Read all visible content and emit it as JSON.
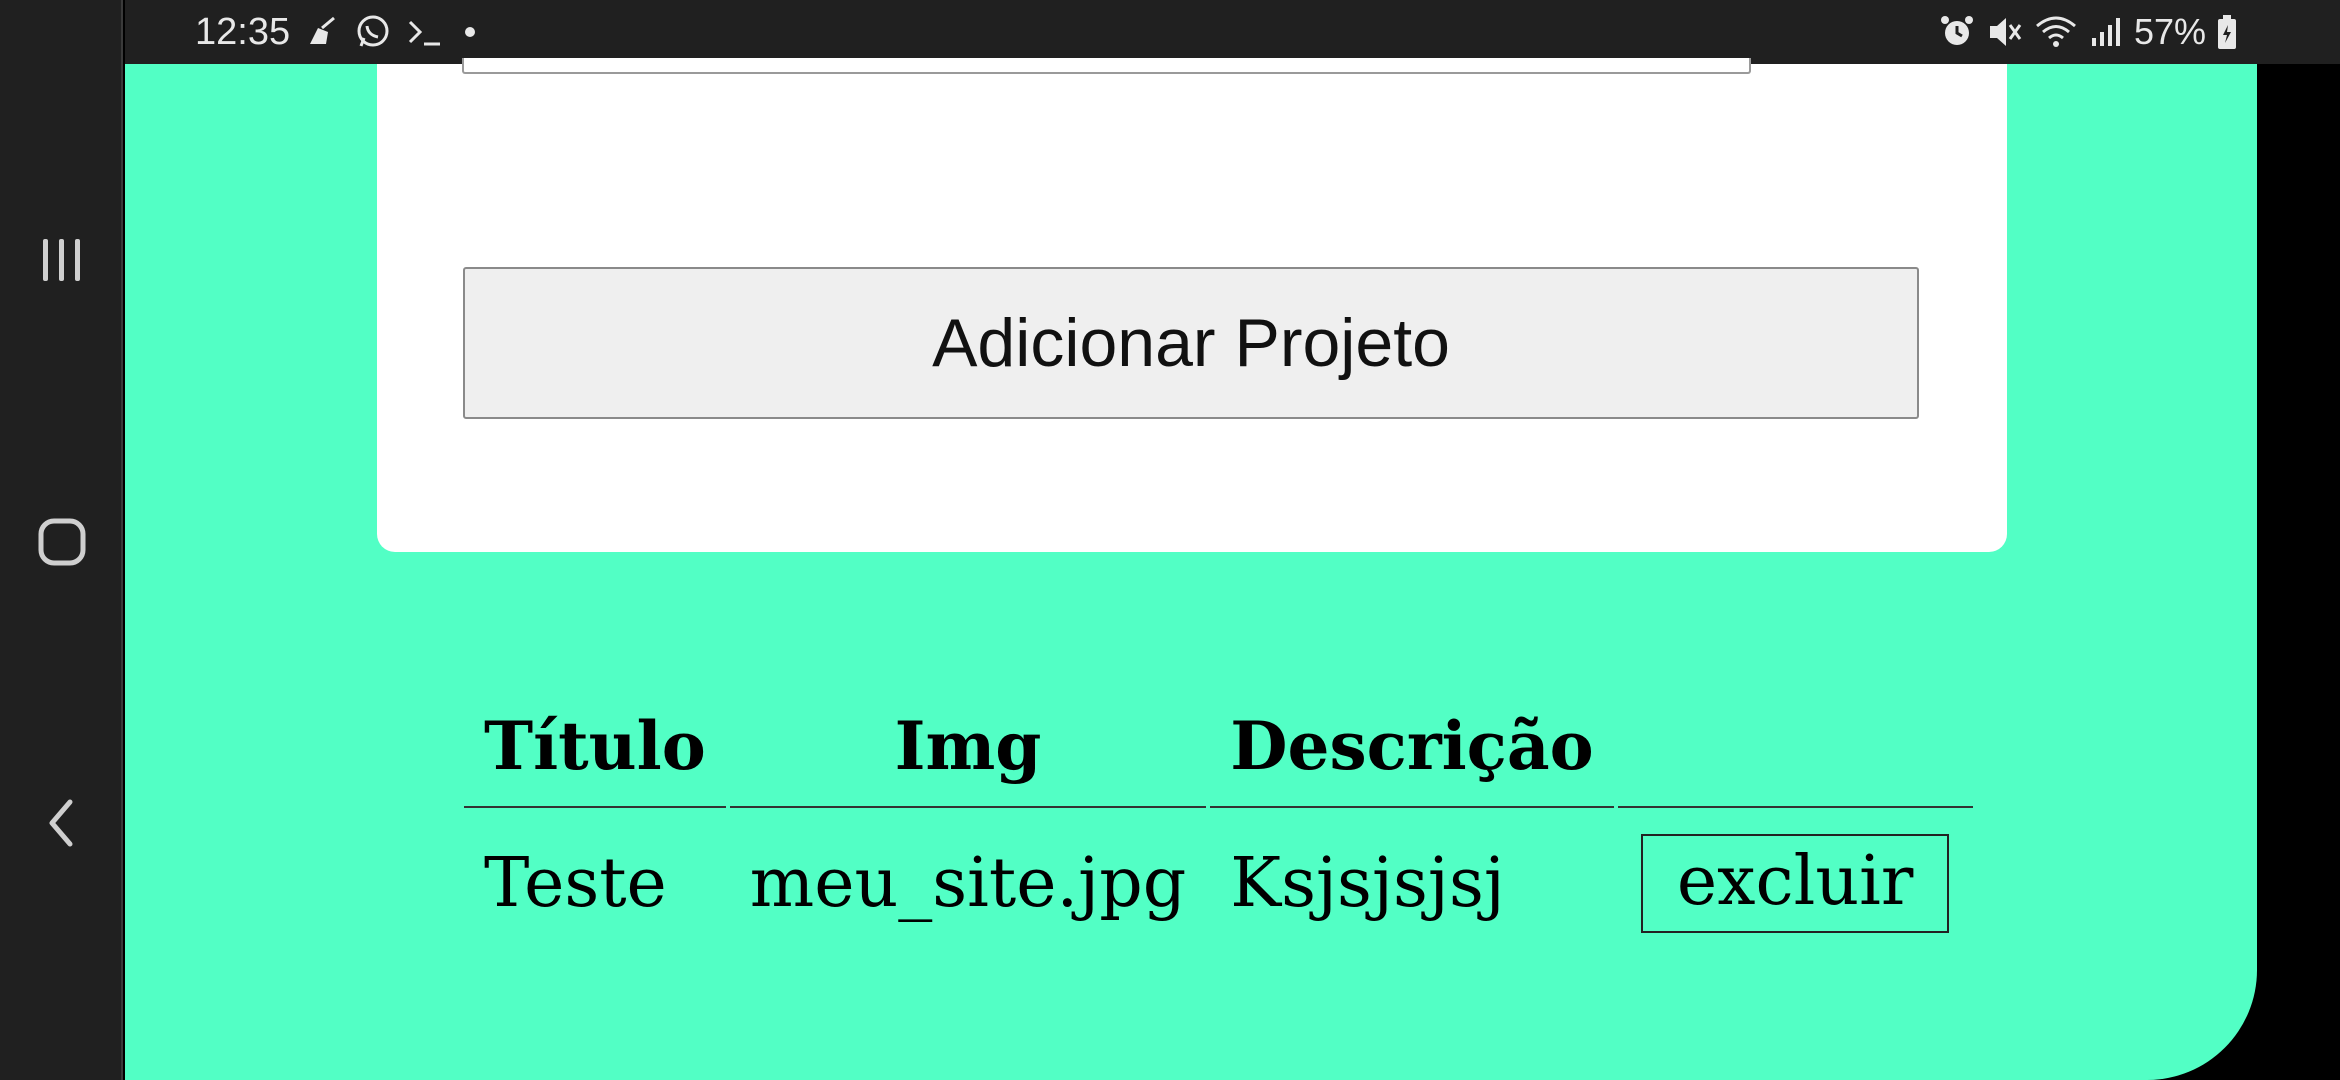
{
  "status_bar": {
    "time": "12:35",
    "left_icons": [
      "cleaner-icon",
      "whatsapp-icon",
      "terminal-icon",
      "dot-icon"
    ],
    "right_icons": [
      "alarm-icon",
      "mute-icon",
      "wifi-icon",
      "signal-icon"
    ],
    "battery_percent": "57%"
  },
  "nav_bar": {
    "buttons": [
      "recent-apps-icon",
      "home-icon",
      "back-icon"
    ]
  },
  "form": {
    "add_button_label": "Adicionar Projeto"
  },
  "table": {
    "headers": [
      "Título",
      "Img",
      "Descrição",
      ""
    ],
    "rows": [
      {
        "titulo": "Teste",
        "img": "meu_site.jpg",
        "descricao": "Ksjsjsjsj",
        "action_label": "excluir"
      }
    ]
  },
  "colors": {
    "app_background": "#52ffc5",
    "card_background": "#ffffff",
    "system_bar": "#202020"
  }
}
